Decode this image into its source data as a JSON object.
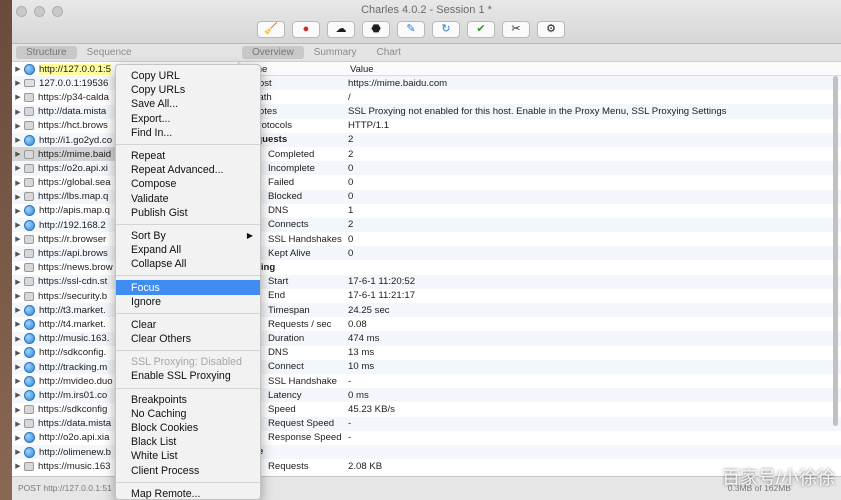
{
  "window": {
    "title": "Charles 4.0.2 - Session 1 *"
  },
  "toolbar": [
    {
      "name": "broom-icon",
      "glyph": "🧹"
    },
    {
      "name": "record-icon",
      "glyph": "●",
      "color": "#d52b2b"
    },
    {
      "name": "throttle-icon",
      "glyph": "☁"
    },
    {
      "name": "breakpoint-icon",
      "glyph": "⬣"
    },
    {
      "name": "compose-pen-icon",
      "glyph": "✎",
      "color": "#2f7ad8"
    },
    {
      "name": "repeat-icon",
      "glyph": "↻",
      "color": "#2f7ad8"
    },
    {
      "name": "validate-check-icon",
      "glyph": "✔",
      "color": "#2c9a2c"
    },
    {
      "name": "tools-icon",
      "glyph": "✂"
    },
    {
      "name": "settings-gear-icon",
      "glyph": "⚙"
    }
  ],
  "left_tabs": [
    "Structure",
    "Sequence"
  ],
  "right_tabs": [
    "Overview",
    "Summary",
    "Chart"
  ],
  "tree": [
    {
      "icon": "globe",
      "host": "http://127.0.0.1:5"
    },
    {
      "icon": "disk",
      "host": "127.0.0.1:19536"
    },
    {
      "icon": "lock",
      "host": "https://p34-calda"
    },
    {
      "icon": "lock",
      "host": "http://data.mista"
    },
    {
      "icon": "lock",
      "host": "https://hct.brows"
    },
    {
      "icon": "globe",
      "host": "http://i1.go2yd.co"
    },
    {
      "icon": "lock",
      "host": "https://mime.baid"
    },
    {
      "icon": "lock",
      "host": "https://o2o.api.xi"
    },
    {
      "icon": "lock",
      "host": "https://global.sea"
    },
    {
      "icon": "lock",
      "host": "https://lbs.map.q"
    },
    {
      "icon": "globe",
      "host": "http://apis.map.q"
    },
    {
      "icon": "globe",
      "host": "http://192.168.2"
    },
    {
      "icon": "lock",
      "host": "https://r.browser"
    },
    {
      "icon": "lock",
      "host": "https://api.brows"
    },
    {
      "icon": "lock",
      "host": "https://news.brow"
    },
    {
      "icon": "lock",
      "host": "https://ssl-cdn.st"
    },
    {
      "icon": "lock",
      "host": "https://security.b"
    },
    {
      "icon": "globe",
      "host": "http://t3.market."
    },
    {
      "icon": "globe",
      "host": "http://t4.market."
    },
    {
      "icon": "globe",
      "host": "http://music.163."
    },
    {
      "icon": "globe",
      "host": "http://sdkconfig."
    },
    {
      "icon": "globe",
      "host": "http://tracking.m"
    },
    {
      "icon": "globe",
      "host": "http://mvideo.duo"
    },
    {
      "icon": "globe",
      "host": "http://m.irs01.co"
    },
    {
      "icon": "lock",
      "host": "https://sdkconfig"
    },
    {
      "icon": "lock",
      "host": "https://data.mista"
    },
    {
      "icon": "globe",
      "host": "http://o2o.api.xia"
    },
    {
      "icon": "globe",
      "host": "http://olimenew.b"
    },
    {
      "icon": "lock",
      "host": "https://music.163"
    }
  ],
  "status": {
    "left": "POST http://127.0.0.1:51",
    "right": "0.3MB of 162MB"
  },
  "overview_header": {
    "name": "Name",
    "value": "Value"
  },
  "overview": [
    {
      "k": "Host",
      "v": "https://mime.baidu.com",
      "lvl": "top"
    },
    {
      "k": "Path",
      "v": "/",
      "lvl": "top"
    },
    {
      "k": "Notes",
      "v": "SSL Proxying not enabled for this host. Enable in the Proxy Menu, SSL Proxying Settings",
      "lvl": "top"
    },
    {
      "k": "Protocols",
      "v": "HTTP/1.1",
      "lvl": "top"
    },
    {
      "k": "Requests",
      "v": "2",
      "lvl": "grp"
    },
    {
      "k": "Completed",
      "v": "2",
      "lvl": "sub"
    },
    {
      "k": "Incomplete",
      "v": "0",
      "lvl": "sub"
    },
    {
      "k": "Failed",
      "v": "0",
      "lvl": "sub"
    },
    {
      "k": "Blocked",
      "v": "0",
      "lvl": "sub"
    },
    {
      "k": "DNS",
      "v": "1",
      "lvl": "sub"
    },
    {
      "k": "Connects",
      "v": "2",
      "lvl": "sub"
    },
    {
      "k": "SSL Handshakes",
      "v": "0",
      "lvl": "sub"
    },
    {
      "k": "Kept Alive",
      "v": "0",
      "lvl": "sub"
    },
    {
      "k": "Timing",
      "v": "",
      "lvl": "grp"
    },
    {
      "k": "Start",
      "v": "17-6-1 11:20:52",
      "lvl": "sub"
    },
    {
      "k": "End",
      "v": "17-6-1 11:21:17",
      "lvl": "sub"
    },
    {
      "k": "Timespan",
      "v": "24.25 sec",
      "lvl": "sub"
    },
    {
      "k": "Requests / sec",
      "v": "0.08",
      "lvl": "sub"
    },
    {
      "k": "Duration",
      "v": "474 ms",
      "lvl": "sub"
    },
    {
      "k": "DNS",
      "v": "13 ms",
      "lvl": "sub"
    },
    {
      "k": "Connect",
      "v": "10 ms",
      "lvl": "sub"
    },
    {
      "k": "SSL Handshake",
      "v": "-",
      "lvl": "sub"
    },
    {
      "k": "Latency",
      "v": "0 ms",
      "lvl": "sub"
    },
    {
      "k": "Speed",
      "v": "45.23 KB/s",
      "lvl": "sub"
    },
    {
      "k": "Request Speed",
      "v": "-",
      "lvl": "sub"
    },
    {
      "k": "Response Speed",
      "v": "-",
      "lvl": "sub"
    },
    {
      "k": "Size",
      "v": "",
      "lvl": "grp"
    },
    {
      "k": "Requests",
      "v": "2.08 KB",
      "lvl": "sub"
    }
  ],
  "context_menu": [
    [
      {
        "label": "Copy URL"
      },
      {
        "label": "Copy URLs"
      },
      {
        "label": "Save All..."
      },
      {
        "label": "Export..."
      },
      {
        "label": "Find In..."
      }
    ],
    [
      {
        "label": "Repeat"
      },
      {
        "label": "Repeat Advanced..."
      },
      {
        "label": "Compose"
      },
      {
        "label": "Validate"
      },
      {
        "label": "Publish Gist"
      }
    ],
    [
      {
        "label": "Sort By",
        "submenu": true
      },
      {
        "label": "Expand All"
      },
      {
        "label": "Collapse All"
      }
    ],
    [
      {
        "label": "Focus",
        "highlight": true
      },
      {
        "label": "Ignore"
      }
    ],
    [
      {
        "label": "Clear"
      },
      {
        "label": "Clear Others"
      }
    ],
    [
      {
        "label": "SSL Proxying: Disabled",
        "disabled": true
      },
      {
        "label": "Enable SSL Proxying"
      }
    ],
    [
      {
        "label": "Breakpoints"
      },
      {
        "label": "No Caching"
      },
      {
        "label": "Block Cookies"
      },
      {
        "label": "Black List"
      },
      {
        "label": "White List"
      },
      {
        "label": "Client Process"
      }
    ],
    [
      {
        "label": "Map Remote..."
      }
    ]
  ],
  "watermark": "百家号/小徐徐"
}
